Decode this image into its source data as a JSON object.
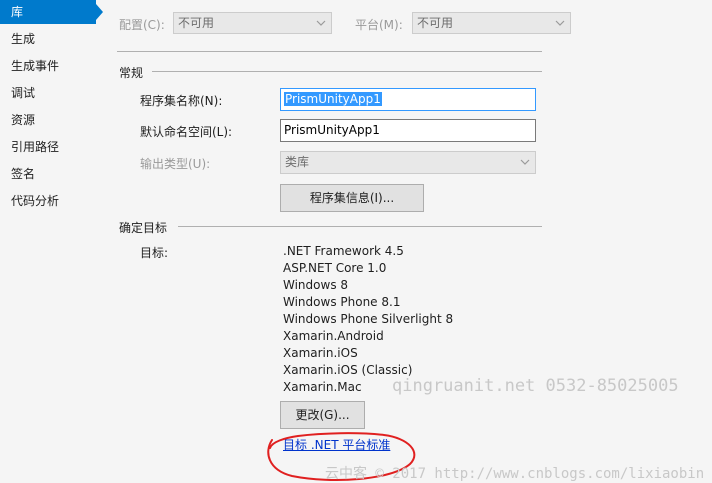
{
  "sidebar": {
    "items": [
      {
        "label": "库",
        "active": true
      },
      {
        "label": "生成",
        "active": false
      },
      {
        "label": "生成事件",
        "active": false
      },
      {
        "label": "调试",
        "active": false
      },
      {
        "label": "资源",
        "active": false
      },
      {
        "label": "引用路径",
        "active": false
      },
      {
        "label": "签名",
        "active": false
      },
      {
        "label": "代码分析",
        "active": false
      }
    ],
    "accent_color": "#007acc"
  },
  "toolbar": {
    "config_label": "配置(C):",
    "config_value": "不可用",
    "platform_label": "平台(M):",
    "platform_value": "不可用"
  },
  "general": {
    "title": "常规",
    "assembly_name_label": "程序集名称(N):",
    "assembly_name_value": "PrismUnityApp1",
    "default_namespace_label": "默认命名空间(L):",
    "default_namespace_value": "PrismUnityApp1",
    "output_type_label": "输出类型(U):",
    "output_type_value": "类库",
    "assembly_info_button": "程序集信息(I)..."
  },
  "targeting": {
    "title": "确定目标",
    "target_label": "目标:",
    "frameworks": [
      ".NET Framework 4.5",
      "ASP.NET Core 1.0",
      "Windows 8",
      "Windows Phone 8.1",
      "Windows Phone Silverlight 8",
      "Xamarin.Android",
      "Xamarin.iOS",
      "Xamarin.iOS (Classic)",
      "Xamarin.Mac"
    ],
    "change_button": "更改(G)...",
    "net_standard_link": "目标 .NET 平台标准"
  },
  "watermarks": {
    "line1": "qingruanit.net 0532-85025005",
    "line2": "云中客 © 2017 http://www.cnblogs.com/lixiaobin"
  },
  "colors": {
    "selection": "#3399ff",
    "link": "#0033cc",
    "annotation": "#e02020"
  }
}
